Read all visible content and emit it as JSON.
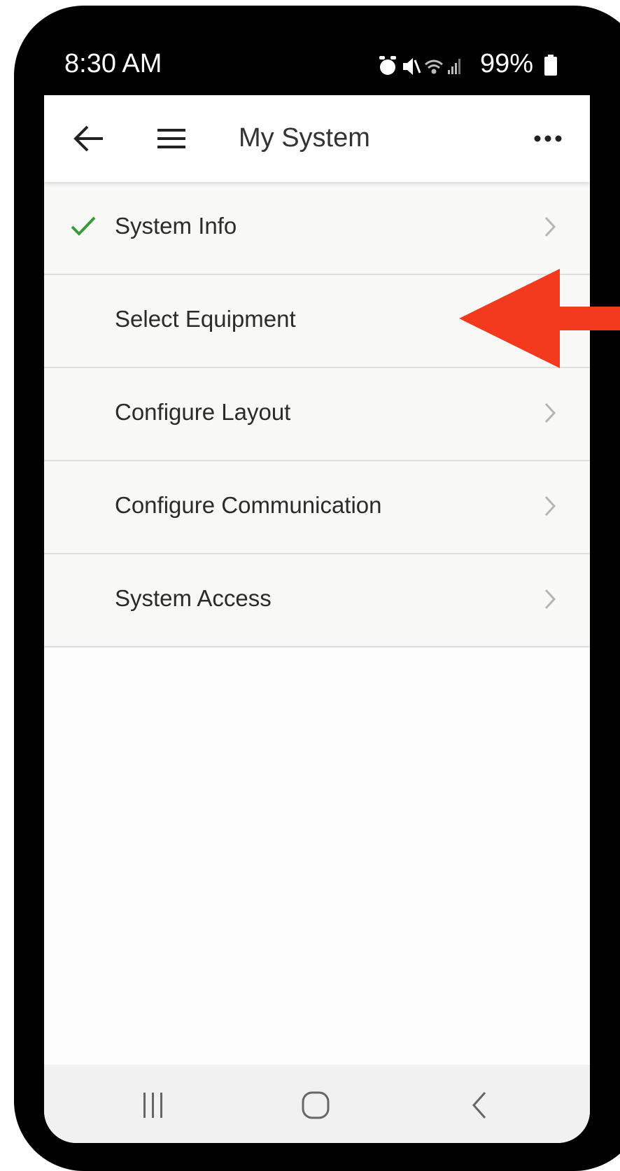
{
  "status_bar": {
    "time": "8:30 AM",
    "battery": "99%",
    "icons": [
      "alarm-icon",
      "mute-icon",
      "wifi-icon",
      "signal-icon",
      "battery-icon"
    ]
  },
  "app_bar": {
    "title": "My System",
    "back_icon": "arrow-left-icon",
    "menu_icon": "hamburger-icon",
    "more_icon": "more-horizontal-icon"
  },
  "list": {
    "items": [
      {
        "label": "System Info",
        "completed": true,
        "chevron": true
      },
      {
        "label": "Select Equipment",
        "completed": false,
        "chevron": true
      },
      {
        "label": "Configure Layout",
        "completed": false,
        "chevron": true
      },
      {
        "label": "Configure Communication",
        "completed": false,
        "chevron": true
      },
      {
        "label": "System Access",
        "completed": false,
        "chevron": true
      }
    ]
  },
  "nav_bar": {
    "buttons": [
      "recent-apps-icon",
      "home-icon",
      "back-icon"
    ]
  },
  "colors": {
    "frame": "#000000",
    "check": "#3a9a3a",
    "annotation_arrow": "#f33a1e",
    "list_bg": "#f8f9f6",
    "nav_bg": "#f1f1f1"
  }
}
